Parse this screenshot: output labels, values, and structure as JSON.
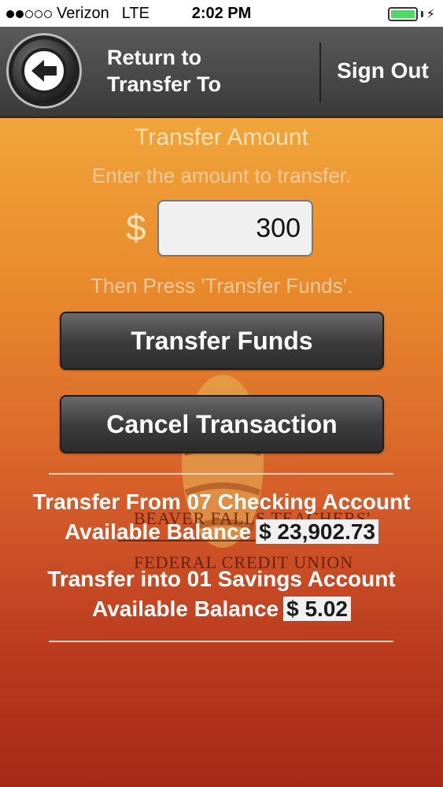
{
  "status_bar": {
    "carrier": "Verizon",
    "network": "LTE",
    "time": "2:02 PM"
  },
  "nav": {
    "back_label_line1": "Return to",
    "back_label_line2": "Transfer To",
    "sign_out": "Sign Out"
  },
  "transfer": {
    "title": "Transfer Amount",
    "subtitle": "Enter the amount to transfer.",
    "currency_symbol": "$",
    "amount_value": "300",
    "instruction": "Then Press 'Transfer Funds'.",
    "transfer_button": "Transfer Funds",
    "cancel_button": "Cancel Transaction"
  },
  "logo": {
    "line1": "BEAVER FALLS TEACHERS'",
    "line2": "FEDERAL CREDIT UNION"
  },
  "accounts": {
    "from_title": "Transfer From 07 Checking Account",
    "from_balance_label": "Available Balance",
    "from_balance": "$ 23,902.73",
    "into_title": "Transfer into 01 Savings Account",
    "into_balance_label": "Available Balance",
    "into_balance": "$ 5.02"
  },
  "colors": {
    "nav_background": "#4a4a4a",
    "background_top": "#f0a53a",
    "background_bottom": "#a62a18",
    "button": "#3d3d3d",
    "battery": "#4cd964"
  }
}
